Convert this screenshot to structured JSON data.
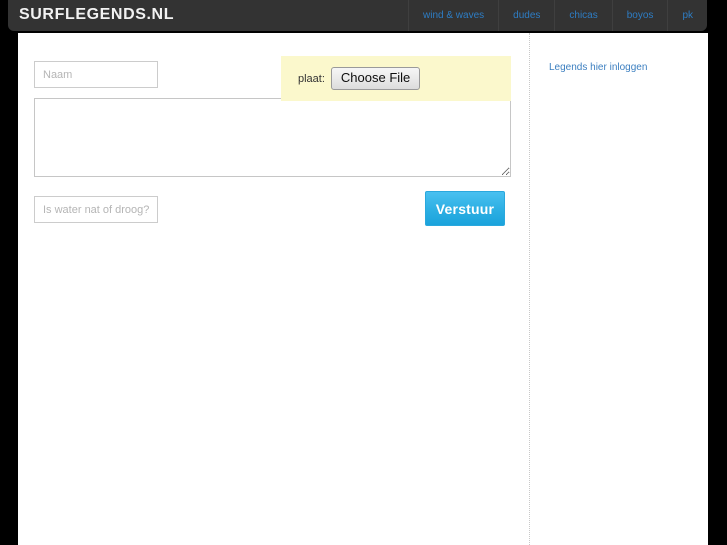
{
  "header": {
    "brand": "SURFLEGENDS.NL",
    "nav": [
      {
        "label": "wind & waves"
      },
      {
        "label": "dudes"
      },
      {
        "label": "chicas"
      },
      {
        "label": "boyos"
      },
      {
        "label": "pk"
      }
    ]
  },
  "form": {
    "name_field": {
      "placeholder": "Naam",
      "value": ""
    },
    "message_field": {
      "placeholder": "",
      "value": ""
    },
    "captcha_field": {
      "placeholder": "Is water nat of droog?",
      "value": ""
    },
    "upload": {
      "label": "plaat:",
      "button_label": "Choose File",
      "background_color": "#fbf8cc"
    },
    "submit": {
      "label": "Verstuur",
      "accent_color": "#2cafe3"
    }
  },
  "sidebar": {
    "login_link": "Legends hier inloggen"
  },
  "theme": {
    "page_background": "#000000",
    "header_background": "#333333",
    "nav_link_color": "#2e7dc4",
    "container_background": "#ffffff",
    "link_color": "#3c7fc0"
  }
}
